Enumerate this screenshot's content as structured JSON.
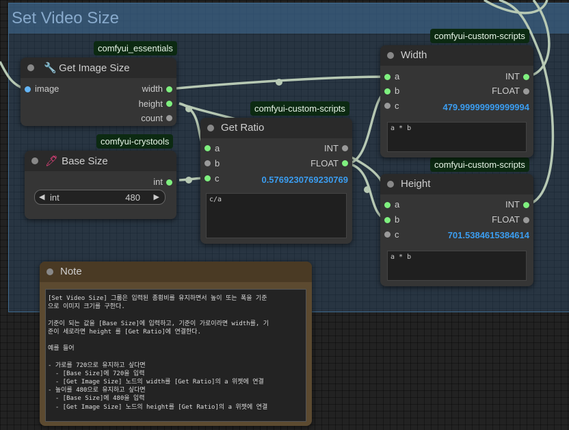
{
  "group": {
    "title": "Set Video Size"
  },
  "badges": {
    "essentials": "comfyui_essentials",
    "crystools": "comfyui-crystools",
    "scripts_ratio": "comfyui-custom-scripts",
    "scripts_width": "comfyui-custom-scripts",
    "scripts_height": "comfyui-custom-scripts"
  },
  "get_image_size": {
    "title": "Get Image Size",
    "icon": "wrench-icon",
    "input": "image",
    "outputs": [
      "width",
      "height",
      "count"
    ]
  },
  "base_size": {
    "title": "Base Size",
    "icon": "pipette-icon",
    "output": "int",
    "widget": {
      "name": "int",
      "value": "480"
    }
  },
  "get_ratio": {
    "title": "Get Ratio",
    "inputs": [
      "a",
      "b",
      "c"
    ],
    "outputs": [
      "INT",
      "FLOAT"
    ],
    "value": "0.5769230769230769",
    "expression": "c/a"
  },
  "width_node": {
    "title": "Width",
    "inputs": [
      "a",
      "b",
      "c"
    ],
    "outputs": [
      "INT",
      "FLOAT"
    ],
    "value": "479.99999999999994",
    "expression": "a * b"
  },
  "height_node": {
    "title": "Height",
    "inputs": [
      "a",
      "b",
      "c"
    ],
    "outputs": [
      "INT",
      "FLOAT"
    ],
    "value": "701.5384615384614",
    "expression": "a * b"
  },
  "note": {
    "title": "Note",
    "text": "[Set Video Size] 그룹은 입력된 종횡비를 유지하면서 높이 또는 폭을 기준\n으로 이미지 크기를 구한다.\n\n기준이 되는 값을 [Base Size]에 입력하고, 기준이 가로이라면 width를, 기\n준이 세로라면 height 를 [Get Ratio]에 연결한다.\n\n예를 들어\n\n- 가로를 720으로 유지하고 싶다면\n  - [Base Size]에 720을 입력\n  - [Get Image Size] 노드의 width를 [Get Ratio]의 a 위젯에 연결\n- 높이를 480으로 유지하고 싶다면\n  - [Base Size]에 480을 입력\n  - [Get Image Size] 노드의 height를 [Get Ratio]의 a 위젯에 연결"
  },
  "colors": {
    "wire": "#b7c9b4",
    "group_bg": "#335577",
    "badge_bg": "#0c2a12",
    "value_blue": "#3b9df0",
    "slot_green": "#7ff07f",
    "note_bg": "#5c4a30"
  }
}
